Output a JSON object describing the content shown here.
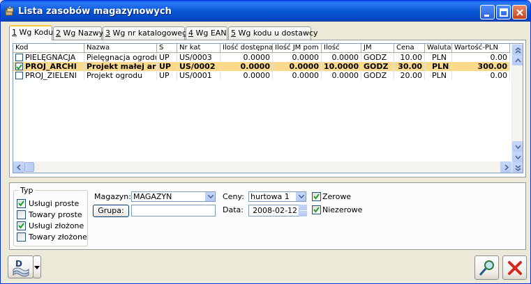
{
  "window": {
    "title": "Lista zasobów magazynowych",
    "icon": "warehouse-icon"
  },
  "tabs": [
    {
      "key": "1",
      "label": " Wg Kodu"
    },
    {
      "key": "2",
      "label": " Wg Nazwy"
    },
    {
      "key": "3",
      "label": " Wg nr katalogowego"
    },
    {
      "key": "4",
      "label": " Wg EAN"
    },
    {
      "key": "5",
      "label": " Wg kodu u dostawcy"
    }
  ],
  "table": {
    "columns": [
      "Kod",
      "Nazwa",
      "S",
      "Nr kat",
      "Ilość dostępna",
      "Ilość JM pom",
      "Ilość",
      "JM",
      "Cena",
      "Waluta",
      "Wartość-PLN"
    ],
    "rows": [
      {
        "checked": false,
        "kod": "PIELĘGNACJA",
        "nazwa": "Pielęgnacja ogrodu",
        "s": "UP",
        "nrkat": "US/0003",
        "ilosc_dost": "0.0000",
        "ilosc_jm": "0.0000",
        "ilosc": "0.0000",
        "jm": "GODZ",
        "cena": "10.00",
        "waluta": "PLN",
        "wartosc": "0.00"
      },
      {
        "checked": true,
        "kod": "PROJ_ARCHI",
        "nazwa": "Projekt małej arch",
        "s": "UP",
        "nrkat": "US/0002",
        "ilosc_dost": "0.0000",
        "ilosc_jm": "0.0000",
        "ilosc": "10.0000",
        "jm": "GODZ",
        "cena": "30.00",
        "waluta": "PLN",
        "wartosc": "300.00"
      },
      {
        "checked": false,
        "kod": "PROJ_ZIELENI",
        "nazwa": "Projekt ogrodu",
        "s": "UP",
        "nrkat": "US/0001",
        "ilosc_dost": "0.0000",
        "ilosc_jm": "0.0000",
        "ilosc": "0.0000",
        "jm": "GODZ",
        "cena": "20.00",
        "waluta": "PLN",
        "wartosc": "0.00"
      }
    ]
  },
  "filters": {
    "typ_legend": "Typ",
    "typ_options": [
      {
        "label": "Usługi proste",
        "checked": true
      },
      {
        "label": "Towary proste",
        "checked": false
      },
      {
        "label": "Usługi złożone",
        "checked": true
      },
      {
        "label": "Towary złożone",
        "checked": false
      }
    ],
    "magazyn_label": "Magazyn:",
    "magazyn_value": "MAGAZYN",
    "grupa_button": "Grupa:",
    "grupa_value": "",
    "ceny_label": "Ceny:",
    "ceny_value": "hurtowa 1",
    "data_label": "Data:",
    "data_value": "2008-02-12",
    "zerowe_label": "Zerowe",
    "zerowe_checked": true,
    "niezerowe_label": "Niezerowe",
    "niezerowe_checked": true
  },
  "colors": {
    "selected_row": "#FBD98A",
    "titlebar": "#0756D6"
  }
}
